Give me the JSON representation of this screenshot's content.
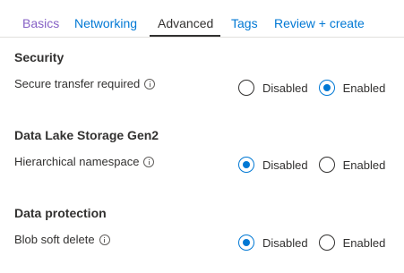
{
  "tabs": [
    {
      "label": "Basics"
    },
    {
      "label": "Networking"
    },
    {
      "label": "Advanced"
    },
    {
      "label": "Tags"
    },
    {
      "label": "Review + create"
    }
  ],
  "sections": [
    {
      "title": "Security",
      "field_label": "Secure transfer required",
      "options": [
        {
          "label": "Disabled",
          "checked": false
        },
        {
          "label": "Enabled",
          "checked": true
        }
      ]
    },
    {
      "title": "Data Lake Storage Gen2",
      "field_label": "Hierarchical namespace",
      "options": [
        {
          "label": "Disabled",
          "checked": true
        },
        {
          "label": "Enabled",
          "checked": false
        }
      ]
    },
    {
      "title": "Data protection",
      "field_label": "Blob soft delete",
      "options": [
        {
          "label": "Disabled",
          "checked": true
        },
        {
          "label": "Enabled",
          "checked": false
        }
      ]
    }
  ],
  "colors": {
    "accent": "#0078d4",
    "visited_tab": "#8661c5",
    "text": "#323130"
  },
  "icons": {
    "info": "info-icon"
  }
}
